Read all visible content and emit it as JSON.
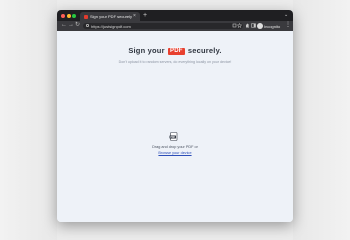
{
  "browser": {
    "tab_title": "Sign your PDF securely",
    "tab_close": "×",
    "new_tab": "+",
    "tab_menu": "⌄",
    "back": "←",
    "forward": "→",
    "reload": "↻",
    "url": "https://justsignpdf.com",
    "incognito_label": "Incognito",
    "menu": "⋮",
    "icons": [
      "back-icon",
      "forward-icon",
      "reload-icon",
      "site-info-icon",
      "share-icon",
      "bookmark-star-icon",
      "extensions-icon",
      "side-panel-icon",
      "incognito-icon",
      "menu-icon"
    ]
  },
  "page": {
    "headline_before": "Sign your",
    "logo_text": "PDF",
    "headline_after": "securely.",
    "subline": "Don't upload it to random servers, do everything locally on your device!",
    "drop_text": "Drag and drop your PDF or",
    "browse_link": "Browse your device",
    "colors": {
      "logo": "#e8402f",
      "link": "#2b4db8",
      "background": "#eef2f8"
    }
  }
}
